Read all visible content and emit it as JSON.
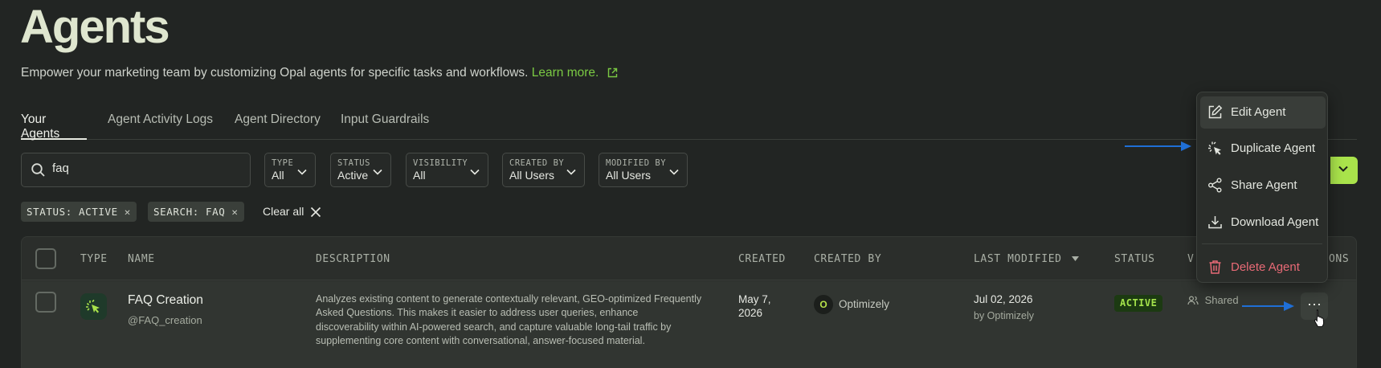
{
  "header": {
    "title": "Agents",
    "subtitle": "Empower your marketing team by customizing Opal agents for specific tasks and workflows.",
    "learn_more": "Learn more."
  },
  "tabs": [
    {
      "label": "Your Agents",
      "active": true
    },
    {
      "label": "Agent Activity Logs",
      "active": false
    },
    {
      "label": "Agent Directory",
      "active": false
    },
    {
      "label": "Input Guardrails",
      "active": false
    }
  ],
  "search": {
    "value": "faq"
  },
  "filters": [
    {
      "label": "TYPE",
      "value": "All"
    },
    {
      "label": "STATUS",
      "value": "Active"
    },
    {
      "label": "VISIBILITY",
      "value": "All"
    },
    {
      "label": "CREATED BY",
      "value": "All Users"
    },
    {
      "label": "MODIFIED BY",
      "value": "All Users"
    }
  ],
  "active_filters": [
    {
      "label": "STATUS: ACTIVE"
    },
    {
      "label": "SEARCH: FAQ"
    }
  ],
  "clear_all": "Clear all",
  "table": {
    "headers": {
      "type": "TYPE",
      "name": "NAME",
      "description": "DESCRIPTION",
      "created": "CREATED",
      "created_by": "CREATED BY",
      "last_modified": "LAST MODIFIED",
      "status": "STATUS",
      "visibility": "V",
      "options": "ONS"
    },
    "rows": [
      {
        "name": "FAQ Creation",
        "handle": "@FAQ_creation",
        "description": "Analyzes existing content to generate contextually relevant, GEO-optimized Frequently Asked Questions. This makes it easier to address user queries, enhance discoverability within AI-powered search, and capture valuable long-tail traffic by supplementing core content with conversational, answer-focused material.",
        "created": "May 7, 2026",
        "created_by_initial": "O",
        "created_by": "Optimizely",
        "last_modified_date": "Jul 02, 2026",
        "last_modified_by": "by Optimizely",
        "status": "ACTIVE",
        "visibility": "Shared",
        "more": "⋯"
      }
    ]
  },
  "menu": {
    "items": [
      {
        "label": "Edit Agent",
        "icon": "edit-icon"
      },
      {
        "label": "Duplicate Agent",
        "icon": "sparkle-cursor-icon"
      },
      {
        "label": "Share Agent",
        "icon": "share-icon"
      },
      {
        "label": "Download Agent",
        "icon": "download-icon"
      },
      {
        "label": "Delete Agent",
        "icon": "trash-icon"
      }
    ]
  },
  "colors": {
    "accent_green": "#a9e34b",
    "link_green": "#7ac943",
    "danger": "#e86a76",
    "annotation_arrow": "#1f6fd6"
  }
}
